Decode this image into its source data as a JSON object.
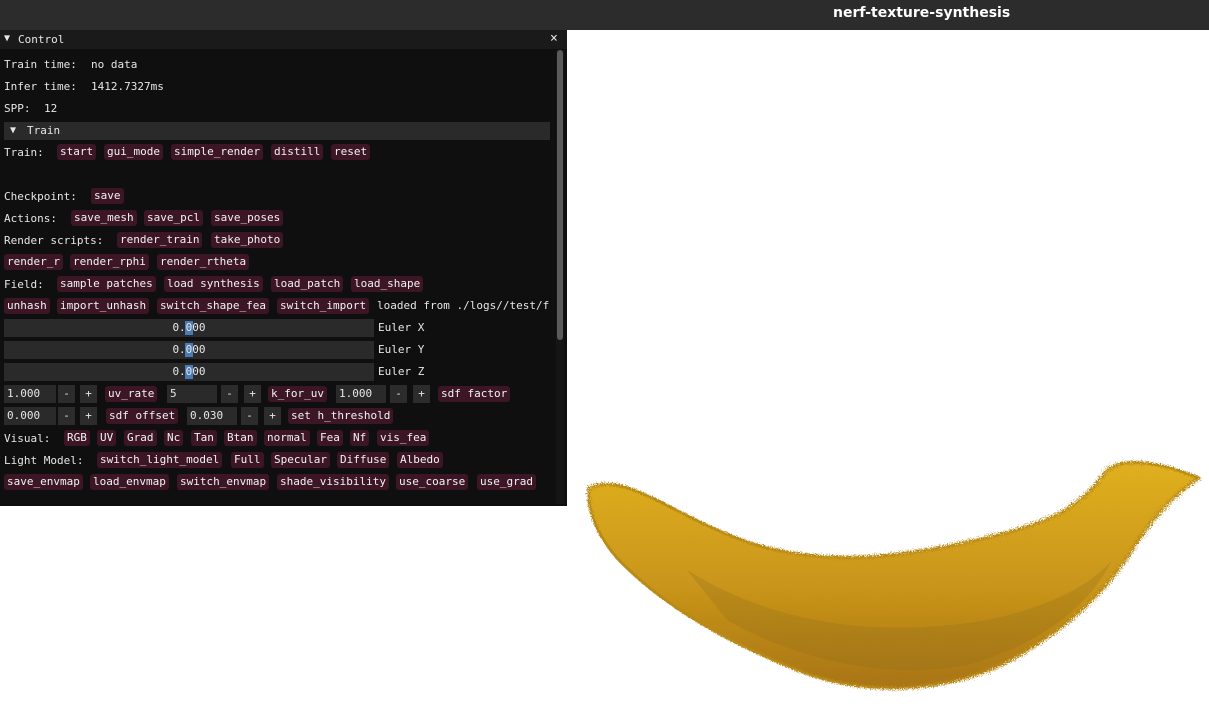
{
  "window": {
    "title": "nerf-texture-synthesis"
  },
  "panel": {
    "title": "Control",
    "close_glyph": "×",
    "collapse_glyph": "▼",
    "train_time": {
      "label": "Train time:",
      "value": "no data"
    },
    "infer_time": {
      "label": "Infer time:",
      "value": "1412.7327ms"
    },
    "spp": {
      "label": "SPP:",
      "value": "12"
    },
    "train_section": "Train",
    "train_row": {
      "label": "Train:",
      "buttons": [
        "start",
        "gui_mode",
        "simple_render",
        "distill",
        "reset"
      ]
    },
    "checkpoint_row": {
      "label": "Checkpoint:",
      "buttons": [
        "save"
      ]
    },
    "actions_row": {
      "label": "Actions:",
      "buttons": [
        "save_mesh",
        "save_pcl",
        "save_poses"
      ]
    },
    "render_scripts_row": {
      "label": "Render scripts:",
      "buttons": [
        "render_train",
        "take_photo"
      ]
    },
    "render_row": {
      "buttons": [
        "render_r",
        "render_rphi",
        "render_rtheta"
      ]
    },
    "field_row": {
      "label": "Field:",
      "buttons": [
        "sample patches",
        "load synthesis",
        "load_patch",
        "load_shape"
      ]
    },
    "unhash_row": {
      "buttons": [
        "unhash",
        "import_unhash",
        "switch_shape_fea",
        "switch_import"
      ],
      "status": "loaded from ./logs//test/f"
    },
    "euler_x": {
      "value": "0.000",
      "label": "Euler X"
    },
    "euler_y": {
      "value": "0.000",
      "label": "Euler Y"
    },
    "euler_z": {
      "value": "0.000",
      "label": "Euler Z"
    },
    "param_row1": {
      "uv_rate_in": "1.000",
      "uv_rate_btn": "uv_rate",
      "k_for_uv_in": "5",
      "k_for_uv_btn": "k_for_uv",
      "sdf_factor_in": "1.000",
      "sdf_factor_btn": "sdf factor"
    },
    "param_row2": {
      "sdf_offset_in": "0.000",
      "sdf_offset_btn": "sdf offset",
      "h_threshold_in": "0.030",
      "h_threshold_btn": "set h_threshold"
    },
    "minus": "-",
    "plus": "+",
    "visual_row": {
      "label": "Visual:",
      "buttons": [
        "RGB",
        "UV",
        "Grad",
        "Nc",
        "Tan",
        "Btan",
        "normal",
        "Fea",
        "Nf",
        "vis_fea"
      ]
    },
    "light_row": {
      "label": "Light Model:",
      "buttons": [
        "switch_light_model",
        "Full",
        "Specular",
        "Diffuse",
        "Albedo"
      ]
    },
    "env_row": {
      "buttons": [
        "save_envmap",
        "load_envmap",
        "switch_envmap",
        "shade_visibility",
        "use_coarse",
        "use_grad"
      ]
    }
  },
  "colors": {
    "button_bg": "#3d1626",
    "panel_bg": "#0f0f0f",
    "slider_grab": "#4a7ab8",
    "titlebar_bg": "#2c2c2c"
  }
}
